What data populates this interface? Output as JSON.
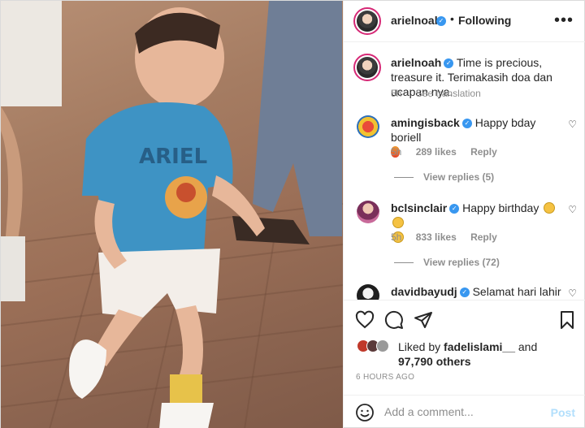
{
  "header": {
    "username": "arielnoah",
    "verified": true,
    "following_label": "Following",
    "more_icon": "more-horizontal-icon"
  },
  "caption": {
    "username": "arielnoah",
    "text": "Time is precious, treasure it. Terimakasih doa dan ucapan nya.",
    "time": "5h",
    "see_translation": "See translation"
  },
  "comments": [
    {
      "username": "amingisback",
      "text": "Happy bday boriell",
      "time": "5h",
      "likes": "289 likes",
      "reply": "Reply",
      "view_replies": "View replies (5)"
    },
    {
      "username": "bclsinclair",
      "text": "Happy birthday",
      "time": "5h",
      "likes": "833 likes",
      "reply": "Reply",
      "view_replies": "View replies (72)"
    },
    {
      "username": "davidbayudj",
      "text": "Selamat hari lahir ya"
    }
  ],
  "liked_by": {
    "prefix": "Liked by",
    "user": "fadelislami__",
    "and": "and",
    "others": "97,790 others"
  },
  "timestamp": "6 HOURS AGO",
  "add_comment": {
    "placeholder": "Add a comment...",
    "post_label": "Post"
  },
  "colors": {
    "verified": "#3897f0",
    "post_disabled": "#b2dffc",
    "muted": "#8e8e8e"
  }
}
